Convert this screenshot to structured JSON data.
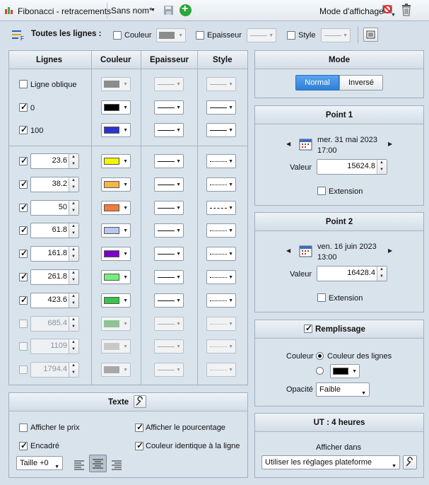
{
  "title": {
    "app": "Fibonacci - retracements",
    "template": "Sans nom*",
    "mode_label": "Mode d'affichage"
  },
  "toolbar": {
    "all_lines": "Toutes les lignes :",
    "color": "Couleur",
    "thickness": "Epaisseur",
    "style": "Style"
  },
  "table": {
    "headers": [
      "Lignes",
      "Couleur",
      "Epaisseur",
      "Style"
    ],
    "fixed": [
      {
        "label": "Ligne oblique",
        "checked": false,
        "color": "#8c8c8c",
        "disabled": true,
        "style": "solid"
      },
      {
        "label": "0",
        "checked": true,
        "color": "#000000",
        "disabled": false,
        "style": "solid"
      },
      {
        "label": "100",
        "checked": true,
        "color": "#2b34d0",
        "disabled": false,
        "style": "solid"
      }
    ],
    "levels": [
      {
        "value": "23.6",
        "checked": true,
        "color": "#f5f500",
        "style": "dotted",
        "disabled": false
      },
      {
        "value": "38.2",
        "checked": true,
        "color": "#f5b44a",
        "style": "dotted",
        "disabled": false
      },
      {
        "value": "50",
        "checked": true,
        "color": "#f57a3c",
        "style": "dashed",
        "disabled": false
      },
      {
        "value": "61.8",
        "checked": true,
        "color": "#b9c6f0",
        "style": "dotted",
        "disabled": false
      },
      {
        "value": "161.8",
        "checked": true,
        "color": "#7a00c8",
        "style": "dotted",
        "disabled": false
      },
      {
        "value": "261.8",
        "checked": true,
        "color": "#74f07a",
        "style": "dotted",
        "disabled": false
      },
      {
        "value": "423.6",
        "checked": true,
        "color": "#3cc34a",
        "style": "dotted",
        "disabled": false
      },
      {
        "value": "685.4",
        "checked": false,
        "color": "#8fc296",
        "style": "dotted",
        "disabled": true
      },
      {
        "value": "1109",
        "checked": false,
        "color": "#c8c8c8",
        "style": "dotted",
        "disabled": true
      },
      {
        "value": "1794.4",
        "checked": false,
        "color": "#a8a8a8",
        "style": "dotted",
        "disabled": true
      }
    ]
  },
  "text_panel": {
    "title": "Texte",
    "show_price": "Afficher le prix",
    "show_percent": "Afficher le pourcentage",
    "framed": "Encadré",
    "same_color": "Couleur identique à la ligne",
    "size": "Taille +0"
  },
  "mode": {
    "title": "Mode",
    "normal": "Normal",
    "inverse": "Inversé"
  },
  "point1": {
    "title": "Point 1",
    "date": "mer. 31 mai 2023",
    "time": "17:00",
    "value_label": "Valeur",
    "value": "15624.8",
    "extension": "Extension"
  },
  "point2": {
    "title": "Point 2",
    "date": "ven. 16 juin 2023",
    "time": "13:00",
    "value_label": "Valeur",
    "value": "16428.4",
    "extension": "Extension"
  },
  "fill": {
    "title": "Remplissage",
    "color_label": "Couleur",
    "option_lines": "Couleur des lignes",
    "custom_color": "#000000",
    "opacity_label": "Opacité",
    "opacity": "Faible"
  },
  "ut": {
    "title": "UT : 4 heures",
    "show_in": "Afficher dans",
    "option": "Utiliser les réglages plateforme"
  },
  "colors": {
    "accent": "#3d8ee6",
    "panel_bg": "#d9e3ec",
    "border": "#9fb0c0"
  }
}
